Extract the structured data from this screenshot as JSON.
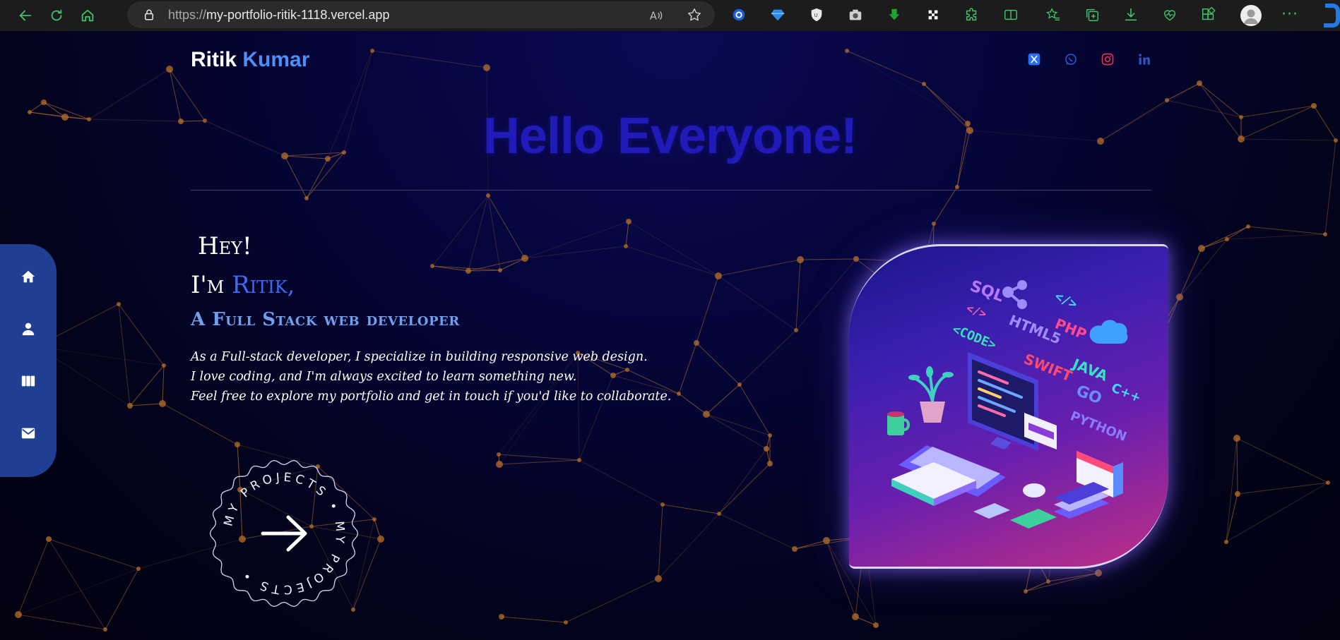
{
  "browser": {
    "url_protocol": "https://",
    "url_host": "my-portfolio-ritik-1118.vercel.app"
  },
  "site": {
    "brand_first": "Ritik",
    "brand_last": "Kumar",
    "headline": "Hello Everyone!",
    "hey": "Hey!",
    "iam_prefix": "I'm",
    "iam_name": "Ritik,",
    "role": "A Full Stack web developer",
    "intro": [
      "As a Full-stack developer, I specialize in building responsive web design.",
      "I love coding, and I'm always excited to learn something new.",
      "Feel free to explore my portfolio and get in touch if you'd like to collaborate."
    ],
    "badge_text": "MY PROJECTS • MY PROJECTS •",
    "hero_words": [
      "SQL",
      "</>",
      "</>",
      "HTML5",
      "PHP",
      "<CODE>",
      "SWIFT",
      "JAVA",
      "GO",
      "C++",
      "PYTHON"
    ]
  },
  "socials": [
    "x-twitter-icon",
    "whatsapp-icon",
    "instagram-icon",
    "linkedin-icon"
  ],
  "sidenav": [
    "home-icon",
    "user-icon",
    "columns-icon",
    "mail-icon"
  ],
  "colors": {
    "accent_blue": "#4d8ef7",
    "headline": "#1f1ab8",
    "sidenav": "#203f93",
    "node": "#b8702a"
  }
}
